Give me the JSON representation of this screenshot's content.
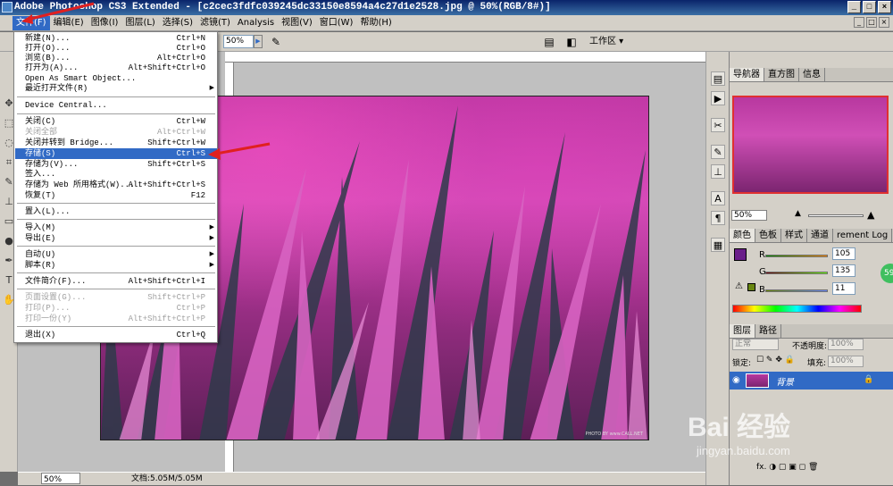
{
  "window": {
    "title": "Adobe Photoshop CS3 Extended - [c2cec3fdfc039245dc33150e8594a4c27d1e2528.jpg @ 50%(RGB/8#)]",
    "btn_min": "_",
    "btn_max": "□",
    "btn_close": "×"
  },
  "menubar": {
    "items": [
      "文件(F)",
      "编辑(E)",
      "图像(I)",
      "图层(L)",
      "选择(S)",
      "滤镜(T)",
      "Analysis",
      "视图(V)",
      "窗口(W)",
      "帮助(H)"
    ]
  },
  "options": {
    "zoom": "50%",
    "workspace": "工作区 ▾"
  },
  "file_menu": {
    "items": [
      {
        "label": "新建(N)...",
        "shortcut": "Ctrl+N"
      },
      {
        "label": "打开(O)...",
        "shortcut": "Ctrl+O"
      },
      {
        "label": "浏览(B)...",
        "shortcut": "Alt+Ctrl+O"
      },
      {
        "label": "打开为(A)...",
        "shortcut": "Alt+Shift+Ctrl+O"
      },
      {
        "label": "Open As Smart Object...",
        "shortcut": ""
      },
      {
        "label": "最近打开文件(R)",
        "shortcut": ""
      },
      {
        "label": "Device Central...",
        "shortcut": ""
      },
      {
        "label": "关闭(C)",
        "shortcut": "Ctrl+W"
      },
      {
        "label": "关闭全部",
        "shortcut": "Alt+Ctrl+W"
      },
      {
        "label": "关闭并转到 Bridge...",
        "shortcut": "Shift+Ctrl+W"
      },
      {
        "label": "存储(S)",
        "shortcut": "Ctrl+S"
      },
      {
        "label": "存储为(V)...",
        "shortcut": "Shift+Ctrl+S"
      },
      {
        "label": "签入...",
        "shortcut": ""
      },
      {
        "label": "存储为 Web 所用格式(W)...",
        "shortcut": "Alt+Shift+Ctrl+S"
      },
      {
        "label": "恢复(T)",
        "shortcut": "F12"
      },
      {
        "label": "置入(L)...",
        "shortcut": ""
      },
      {
        "label": "导入(M)",
        "shortcut": ""
      },
      {
        "label": "导出(E)",
        "shortcut": ""
      },
      {
        "label": "自动(U)",
        "shortcut": ""
      },
      {
        "label": "脚本(R)",
        "shortcut": ""
      },
      {
        "label": "文件简介(F)...",
        "shortcut": "Alt+Shift+Ctrl+I"
      },
      {
        "label": "页面设置(G)...",
        "shortcut": "Shift+Ctrl+P"
      },
      {
        "label": "打印(P)...",
        "shortcut": "Ctrl+P"
      },
      {
        "label": "打印一份(Y)",
        "shortcut": "Alt+Shift+Ctrl+P"
      },
      {
        "label": "退出(X)",
        "shortcut": "Ctrl+Q"
      }
    ]
  },
  "image": {
    "caption": "PHOTO BY www.CALL.NET"
  },
  "status": {
    "zoom": "50%",
    "doc": "文档:5.05M/5.05M"
  },
  "navigator": {
    "tabs": [
      "导航器",
      "直方图",
      "信息"
    ],
    "zoom": "50%"
  },
  "color_panel": {
    "tabs": [
      "颜色",
      "色板",
      "样式",
      "通道",
      "rement Log"
    ],
    "r_label": "R",
    "g_label": "G",
    "b_label": "B",
    "r": "105",
    "g": "135",
    "b": "11",
    "foreground": "#6a1e8a"
  },
  "layers_panel": {
    "tabs": [
      "图层",
      "路径"
    ],
    "blend_mode": "正常",
    "opacity_label": "不透明度:",
    "opacity": "100%",
    "lock_label": "锁定:",
    "fill_label": "填充:",
    "fill": "100%",
    "layer_name": "背景",
    "bottom_icons": "fx. ◑ ▢ ▣ ◻ 🗑"
  },
  "watermark": {
    "main": "Bai 经验",
    "sub": "jingyan.baidu.com"
  },
  "badge": "59"
}
